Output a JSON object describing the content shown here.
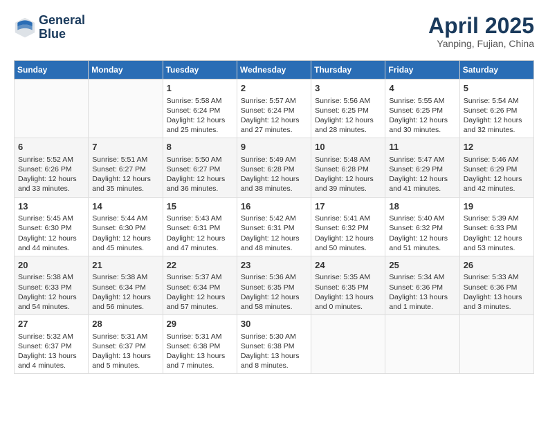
{
  "header": {
    "logo_line1": "General",
    "logo_line2": "Blue",
    "month": "April 2025",
    "location": "Yanping, Fujian, China"
  },
  "days_of_week": [
    "Sunday",
    "Monday",
    "Tuesday",
    "Wednesday",
    "Thursday",
    "Friday",
    "Saturday"
  ],
  "weeks": [
    [
      {
        "day": "",
        "info": ""
      },
      {
        "day": "",
        "info": ""
      },
      {
        "day": "1",
        "info": "Sunrise: 5:58 AM\nSunset: 6:24 PM\nDaylight: 12 hours and 25 minutes."
      },
      {
        "day": "2",
        "info": "Sunrise: 5:57 AM\nSunset: 6:24 PM\nDaylight: 12 hours and 27 minutes."
      },
      {
        "day": "3",
        "info": "Sunrise: 5:56 AM\nSunset: 6:25 PM\nDaylight: 12 hours and 28 minutes."
      },
      {
        "day": "4",
        "info": "Sunrise: 5:55 AM\nSunset: 6:25 PM\nDaylight: 12 hours and 30 minutes."
      },
      {
        "day": "5",
        "info": "Sunrise: 5:54 AM\nSunset: 6:26 PM\nDaylight: 12 hours and 32 minutes."
      }
    ],
    [
      {
        "day": "6",
        "info": "Sunrise: 5:52 AM\nSunset: 6:26 PM\nDaylight: 12 hours and 33 minutes."
      },
      {
        "day": "7",
        "info": "Sunrise: 5:51 AM\nSunset: 6:27 PM\nDaylight: 12 hours and 35 minutes."
      },
      {
        "day": "8",
        "info": "Sunrise: 5:50 AM\nSunset: 6:27 PM\nDaylight: 12 hours and 36 minutes."
      },
      {
        "day": "9",
        "info": "Sunrise: 5:49 AM\nSunset: 6:28 PM\nDaylight: 12 hours and 38 minutes."
      },
      {
        "day": "10",
        "info": "Sunrise: 5:48 AM\nSunset: 6:28 PM\nDaylight: 12 hours and 39 minutes."
      },
      {
        "day": "11",
        "info": "Sunrise: 5:47 AM\nSunset: 6:29 PM\nDaylight: 12 hours and 41 minutes."
      },
      {
        "day": "12",
        "info": "Sunrise: 5:46 AM\nSunset: 6:29 PM\nDaylight: 12 hours and 42 minutes."
      }
    ],
    [
      {
        "day": "13",
        "info": "Sunrise: 5:45 AM\nSunset: 6:30 PM\nDaylight: 12 hours and 44 minutes."
      },
      {
        "day": "14",
        "info": "Sunrise: 5:44 AM\nSunset: 6:30 PM\nDaylight: 12 hours and 45 minutes."
      },
      {
        "day": "15",
        "info": "Sunrise: 5:43 AM\nSunset: 6:31 PM\nDaylight: 12 hours and 47 minutes."
      },
      {
        "day": "16",
        "info": "Sunrise: 5:42 AM\nSunset: 6:31 PM\nDaylight: 12 hours and 48 minutes."
      },
      {
        "day": "17",
        "info": "Sunrise: 5:41 AM\nSunset: 6:32 PM\nDaylight: 12 hours and 50 minutes."
      },
      {
        "day": "18",
        "info": "Sunrise: 5:40 AM\nSunset: 6:32 PM\nDaylight: 12 hours and 51 minutes."
      },
      {
        "day": "19",
        "info": "Sunrise: 5:39 AM\nSunset: 6:33 PM\nDaylight: 12 hours and 53 minutes."
      }
    ],
    [
      {
        "day": "20",
        "info": "Sunrise: 5:38 AM\nSunset: 6:33 PM\nDaylight: 12 hours and 54 minutes."
      },
      {
        "day": "21",
        "info": "Sunrise: 5:38 AM\nSunset: 6:34 PM\nDaylight: 12 hours and 56 minutes."
      },
      {
        "day": "22",
        "info": "Sunrise: 5:37 AM\nSunset: 6:34 PM\nDaylight: 12 hours and 57 minutes."
      },
      {
        "day": "23",
        "info": "Sunrise: 5:36 AM\nSunset: 6:35 PM\nDaylight: 12 hours and 58 minutes."
      },
      {
        "day": "24",
        "info": "Sunrise: 5:35 AM\nSunset: 6:35 PM\nDaylight: 13 hours and 0 minutes."
      },
      {
        "day": "25",
        "info": "Sunrise: 5:34 AM\nSunset: 6:36 PM\nDaylight: 13 hours and 1 minute."
      },
      {
        "day": "26",
        "info": "Sunrise: 5:33 AM\nSunset: 6:36 PM\nDaylight: 13 hours and 3 minutes."
      }
    ],
    [
      {
        "day": "27",
        "info": "Sunrise: 5:32 AM\nSunset: 6:37 PM\nDaylight: 13 hours and 4 minutes."
      },
      {
        "day": "28",
        "info": "Sunrise: 5:31 AM\nSunset: 6:37 PM\nDaylight: 13 hours and 5 minutes."
      },
      {
        "day": "29",
        "info": "Sunrise: 5:31 AM\nSunset: 6:38 PM\nDaylight: 13 hours and 7 minutes."
      },
      {
        "day": "30",
        "info": "Sunrise: 5:30 AM\nSunset: 6:38 PM\nDaylight: 13 hours and 8 minutes."
      },
      {
        "day": "",
        "info": ""
      },
      {
        "day": "",
        "info": ""
      },
      {
        "day": "",
        "info": ""
      }
    ]
  ]
}
